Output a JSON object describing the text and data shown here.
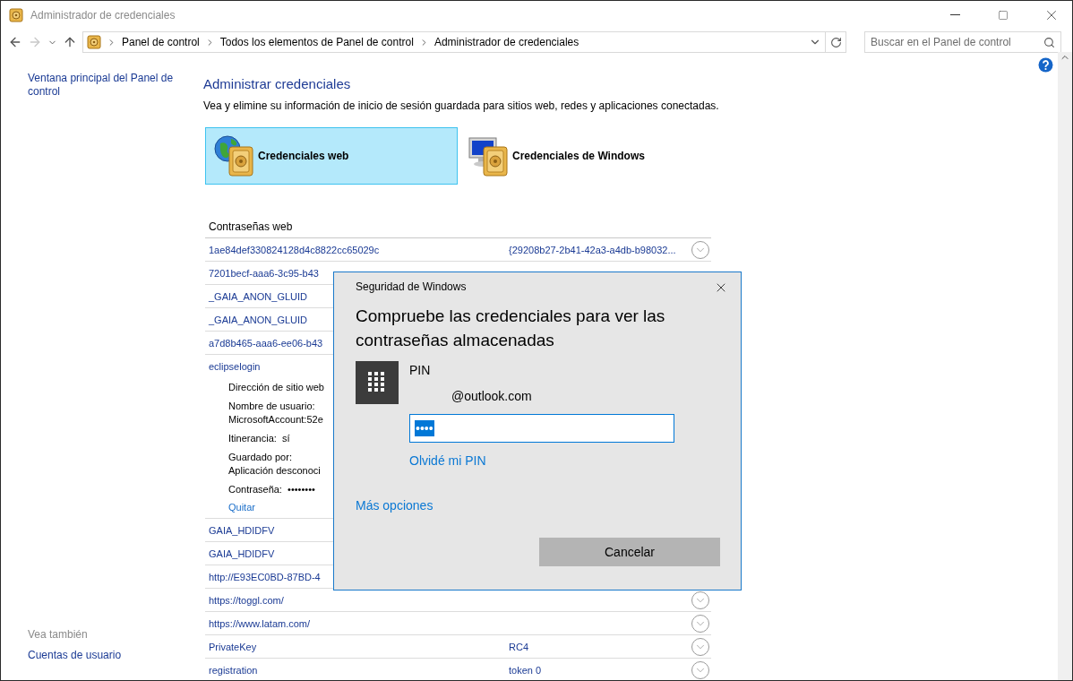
{
  "window": {
    "title": "Administrador de credenciales"
  },
  "address_bar": {
    "crumbs": [
      "Panel de control",
      "Todos los elementos de Panel de control",
      "Administrador de credenciales"
    ]
  },
  "search": {
    "placeholder": "Buscar en el Panel de control"
  },
  "sidebar": {
    "links": [
      "Ventana principal del Panel de control"
    ],
    "see_also_title": "Vea también",
    "see_also": [
      "Cuentas de usuario"
    ]
  },
  "main": {
    "heading": "Administrar credenciales",
    "description": "Vea y elimine su información de inicio de sesión guardada para sitios web, redes y aplicaciones conectadas.",
    "categories": [
      {
        "kind": "web",
        "label": "Credenciales web",
        "selected": true
      },
      {
        "kind": "windows",
        "label": "Credenciales de Windows",
        "selected": false
      }
    ]
  },
  "list": {
    "title": "Contraseñas web",
    "rows": [
      {
        "name": "1ae84def330824128d4c8822cc65029c",
        "value": "{29208b27-2b41-42a3-a4db-b98032...",
        "expand_button": true
      },
      {
        "name": "7201becf-aaa6-3c95-b43"
      },
      {
        "name": "_GAIA_ANON_GLUID"
      },
      {
        "name": "_GAIA_ANON_GLUID"
      },
      {
        "name": "a7d8b465-aaa6-ee06-b43"
      },
      {
        "name": "eclipselogin",
        "expanded": true,
        "details": [
          [
            {
              "label": "Dirección de sitio web"
            }
          ],
          [
            {
              "label": "Nombre de usuario:"
            },
            {
              "label": "MicrosoftAccount:52e"
            }
          ],
          [
            {
              "label": "Itinerancia:",
              "value": "sí"
            }
          ],
          [
            {
              "label": "Guardado por:"
            },
            {
              "label": "Aplicación desconoci"
            }
          ],
          [
            {
              "label": "Contraseña:",
              "value": "••••••••"
            }
          ]
        ],
        "action": "Quitar"
      },
      {
        "name": "GAIA_HDIDFV"
      },
      {
        "name": "GAIA_HDIDFV"
      },
      {
        "name": "http://E93EC0BD-87BD-4"
      },
      {
        "name": "https://toggl.com/",
        "expand_button": true
      },
      {
        "name": "https://www.latam.com/",
        "expand_button": true
      },
      {
        "name": "PrivateKey",
        "value": "RC4",
        "expand_button": true
      },
      {
        "name": "registration",
        "value": "token 0",
        "expand_button": true
      }
    ]
  },
  "dialog": {
    "title": "Seguridad de Windows",
    "heading": "Compruebe las credenciales para ver las contraseñas almacenadas",
    "method": "PIN",
    "account": "@outlook.com",
    "pin_value": "••••",
    "pin_selected": true,
    "forgot_link": "Olvidé mi PIN",
    "more_options": "Más opciones",
    "cancel_button": "Cancelar"
  }
}
